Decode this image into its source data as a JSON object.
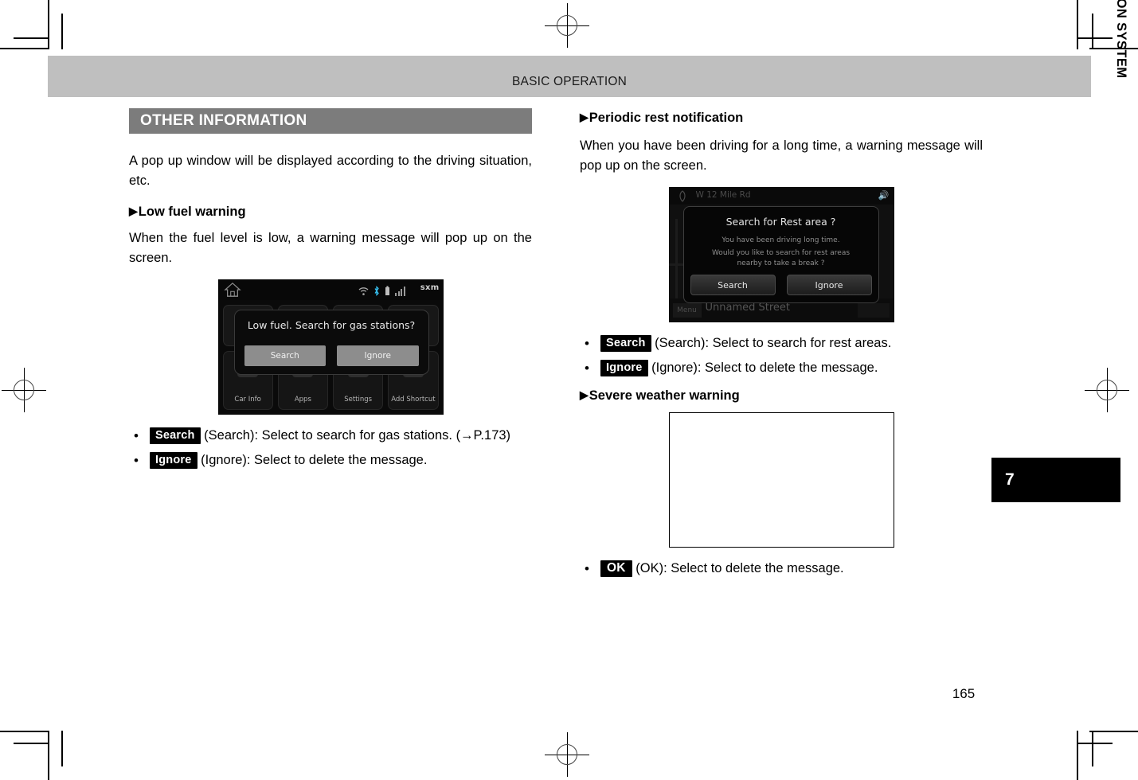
{
  "header": {
    "title": "BASIC OPERATION"
  },
  "side": {
    "chapter_label": "NAVIGATION SYSTEM",
    "chapter_number": "7"
  },
  "footer": {
    "page_number": "165"
  },
  "left_column": {
    "section_title": "OTHER INFORMATION",
    "intro_paragraph": "A pop up window will be displayed according to the driving situation, etc.",
    "subheading": "Low fuel warning",
    "subheading_marker": "▶",
    "paragraph": "When the fuel level is low, a warning message will pop up on the screen.",
    "figure": {
      "name": "low-fuel-home-screen",
      "status_bar": {
        "home_icon": "home-icon",
        "icons": [
          "wifi-icon",
          "bluetooth-icon",
          "battery-icon",
          "signal-bars-icon"
        ],
        "sxm_label": "sxm"
      },
      "dialog": {
        "title": "Low fuel. Search for gas stations?",
        "buttons": [
          "Search",
          "Ignore"
        ]
      },
      "shortcuts": [
        {
          "label": "Car Info",
          "icon": "car-info-icon"
        },
        {
          "label": "Apps",
          "icon": "apps-icon"
        },
        {
          "label": "Settings",
          "icon": "gear-icon"
        },
        {
          "label": "Add Shortcut",
          "icon": "add-shortcut-icon"
        }
      ]
    },
    "bullets": [
      {
        "key": "Search",
        "text": "(Search): Select to search for gas stations. (→P.173)"
      },
      {
        "key": "Ignore",
        "text": "(Ignore): Select to delete the message."
      }
    ]
  },
  "right_column": {
    "subheading_1": "Periodic rest notification",
    "subheading_marker": "▶",
    "paragraph_1": "When you have been driving for a long time, a warning message will pop up on the screen.",
    "figure": {
      "name": "rest-area-map-screen",
      "top_bar": {
        "street": "W 12 Mile Rd",
        "speaker_icon": "speaker-icon"
      },
      "dialog": {
        "title": "Search for Rest area ?",
        "body_line_1": "You have been driving long time.",
        "body_line_2": "Would you like to search for rest areas",
        "body_line_3": "nearby to take a break ?",
        "buttons": [
          "Search",
          "Ignore"
        ]
      },
      "bottom_bar": {
        "menu_label": "Menu",
        "street_label": "Unnamed Street"
      }
    },
    "bullets_1": [
      {
        "key": "Search",
        "text": "(Search): Select to search for rest areas."
      },
      {
        "key": "Ignore",
        "text": "(Ignore): Select to delete the message."
      }
    ],
    "subheading_2": "Severe weather warning",
    "bullets_2": [
      {
        "key": "OK",
        "text": "(OK): Select to delete the message."
      }
    ]
  }
}
